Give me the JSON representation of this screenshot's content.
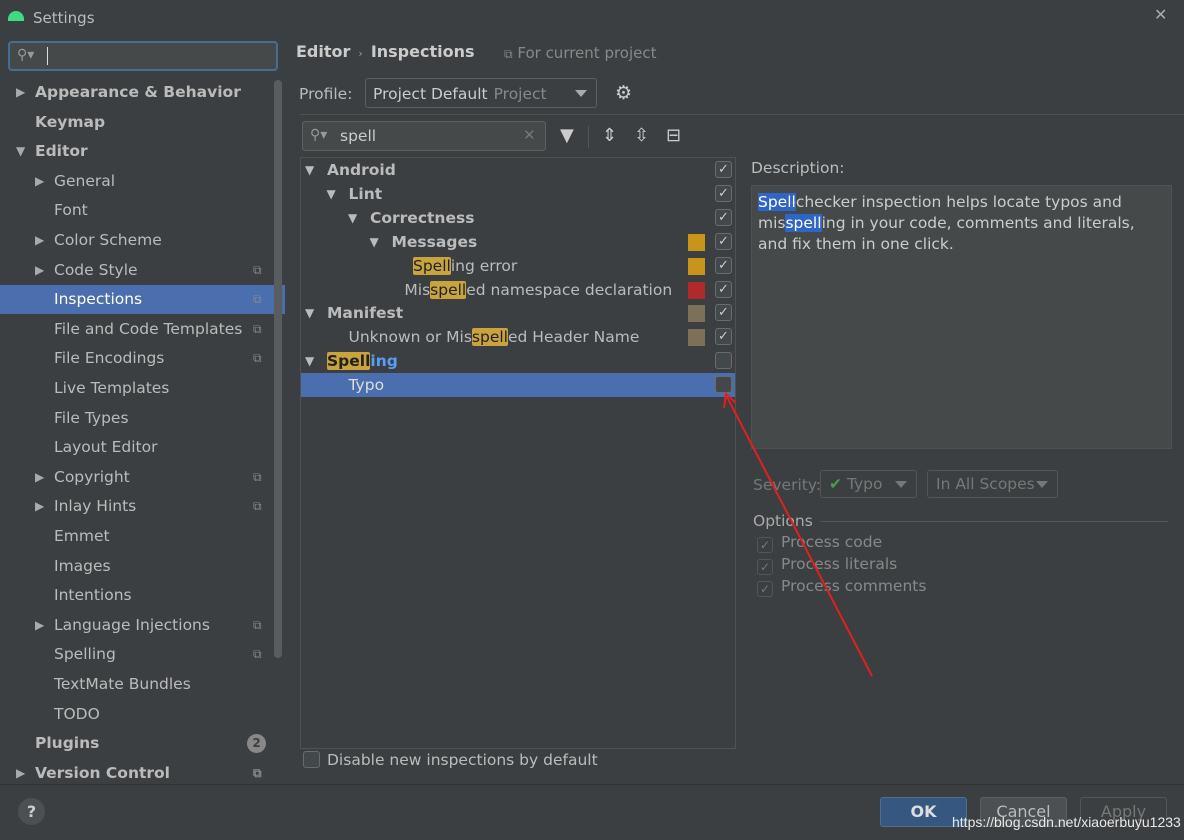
{
  "window": {
    "title": "Settings"
  },
  "sidebar": {
    "search_value": "",
    "items": [
      {
        "label": "Appearance & Behavior",
        "level": 0,
        "arrow": "right",
        "bold": true
      },
      {
        "label": "Keymap",
        "level": 0,
        "bold": true
      },
      {
        "label": "Editor",
        "level": 0,
        "arrow": "down",
        "bold": true
      },
      {
        "label": "General",
        "level": 1,
        "arrow": "right"
      },
      {
        "label": "Font",
        "level": 1
      },
      {
        "label": "Color Scheme",
        "level": 1,
        "arrow": "right"
      },
      {
        "label": "Code Style",
        "level": 1,
        "arrow": "right",
        "proj": true
      },
      {
        "label": "Inspections",
        "level": 1,
        "proj": true,
        "selected": true
      },
      {
        "label": "File and Code Templates",
        "level": 1,
        "proj": true
      },
      {
        "label": "File Encodings",
        "level": 1,
        "proj": true
      },
      {
        "label": "Live Templates",
        "level": 1
      },
      {
        "label": "File Types",
        "level": 1
      },
      {
        "label": "Layout Editor",
        "level": 1
      },
      {
        "label": "Copyright",
        "level": 1,
        "arrow": "right",
        "proj": true
      },
      {
        "label": "Inlay Hints",
        "level": 1,
        "arrow": "right",
        "proj": true
      },
      {
        "label": "Emmet",
        "level": 1
      },
      {
        "label": "Images",
        "level": 1
      },
      {
        "label": "Intentions",
        "level": 1
      },
      {
        "label": "Language Injections",
        "level": 1,
        "arrow": "right",
        "proj": true
      },
      {
        "label": "Spelling",
        "level": 1,
        "proj": true
      },
      {
        "label": "TextMate Bundles",
        "level": 1
      },
      {
        "label": "TODO",
        "level": 1
      },
      {
        "label": "Plugins",
        "level": 0,
        "bold": true,
        "badge": "2"
      },
      {
        "label": "Version Control",
        "level": 0,
        "arrow": "right",
        "bold": true,
        "proj": true
      }
    ]
  },
  "header": {
    "crumb1": "Editor",
    "crumb2": "Inspections",
    "for_current": "For current project"
  },
  "profile": {
    "label": "Profile:",
    "value": "Project Default",
    "sub": "Project"
  },
  "filter": {
    "value": "spell"
  },
  "tree": [
    {
      "pre": "Android",
      "hl": "",
      "post": "",
      "level": 0,
      "arrow": "down",
      "bold": true,
      "checked": true
    },
    {
      "pre": "Lint",
      "hl": "",
      "post": "",
      "level": 1,
      "arrow": "down",
      "bold": true,
      "checked": true
    },
    {
      "pre": "Correctness",
      "hl": "",
      "post": "",
      "level": 2,
      "arrow": "down",
      "bold": true,
      "checked": true
    },
    {
      "pre": "Messages",
      "hl": "",
      "post": "",
      "level": 3,
      "arrow": "down",
      "bold": true,
      "checked": true,
      "color": "#c8951a"
    },
    {
      "pre": "",
      "hl": "Spell",
      "post": "ing error",
      "level": 4,
      "checked": true,
      "color": "#c8951a"
    },
    {
      "pre": "Mis",
      "hl": "spell",
      "post": "ed namespace declaration",
      "level": 3.6,
      "checked": true,
      "color": "#b02a2a"
    },
    {
      "pre": "Manifest",
      "hl": "",
      "post": "",
      "level": 0,
      "arrow": "down",
      "bold": true,
      "checked": true,
      "color": "#7c7158"
    },
    {
      "pre": "Unknown or Mis",
      "hl": "spell",
      "post": "ed Header Name",
      "level": 1,
      "checked": true,
      "color": "#7c7158"
    },
    {
      "pre": "",
      "hl": "Spell",
      "post": "ing",
      "level": 0,
      "arrow": "down",
      "bold": true,
      "checked": false,
      "blue": true
    },
    {
      "pre": "Typo",
      "hl": "",
      "post": "",
      "level": 1,
      "checked": false,
      "selected": true
    }
  ],
  "description": {
    "label": "Description:",
    "parts": [
      {
        "t": "Spell",
        "hl": true
      },
      {
        "t": "checker inspection helps locate typos and mis"
      },
      {
        "t": "spell",
        "hl": true
      },
      {
        "t": "ing in your code, comments and literals, and fix them in one click."
      }
    ]
  },
  "severity": {
    "label": "Severity:",
    "value": "Typo",
    "scope": "In All Scopes"
  },
  "options": {
    "label": "Options",
    "items": [
      {
        "label": "Process code",
        "checked": true
      },
      {
        "label": "Process literals",
        "checked": true
      },
      {
        "label": "Process comments",
        "checked": true
      }
    ]
  },
  "disable_new": {
    "label": "Disable new inspections by default",
    "checked": false
  },
  "footer": {
    "help": "?",
    "ok": "OK",
    "cancel": "Cancel",
    "apply": "Apply"
  },
  "watermark": "https://blog.csdn.net/xiaoerbuyu1233",
  "colors": {
    "selection": "#4b6eaf",
    "highlight": "#c9a33b",
    "annotation_arrow": "#e02020"
  }
}
